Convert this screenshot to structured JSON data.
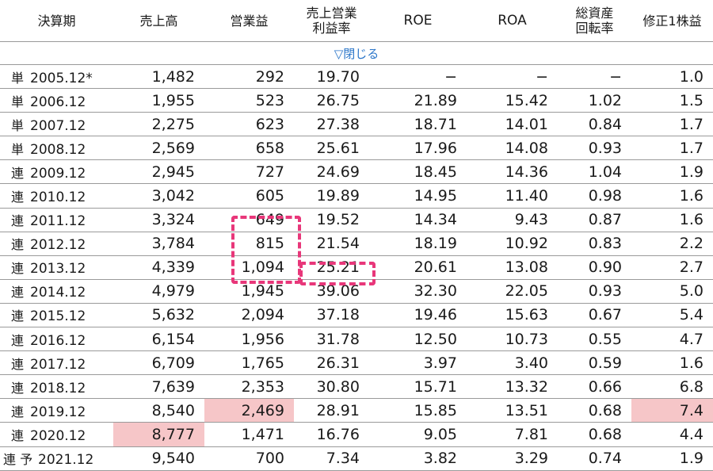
{
  "headers": {
    "period": "決算期",
    "sales": "売上高",
    "operating_profit": "営業益",
    "margin_line1": "売上営業",
    "margin_line2": "利益率",
    "roe": "ROE",
    "roa": "ROA",
    "turnover_line1": "総資産",
    "turnover_line2": "回転率",
    "eps": "修正1株益"
  },
  "toggle_label": "▽閉じる",
  "highlight_color": "#f6c6c8",
  "annotation_color": "#e8377a",
  "rows": [
    {
      "type": "単",
      "date": "2005.12*",
      "sales": "1,482",
      "op": "292",
      "margin": "19.70",
      "roe": "−",
      "roa": "−",
      "turnover": "−",
      "eps": "1.0"
    },
    {
      "type": "単",
      "date": "2006.12",
      "sales": "1,955",
      "op": "523",
      "margin": "26.75",
      "roe": "21.89",
      "roa": "15.42",
      "turnover": "1.02",
      "eps": "1.5"
    },
    {
      "type": "単",
      "date": "2007.12",
      "sales": "2,275",
      "op": "623",
      "margin": "27.38",
      "roe": "18.71",
      "roa": "14.01",
      "turnover": "0.84",
      "eps": "1.7"
    },
    {
      "type": "単",
      "date": "2008.12",
      "sales": "2,569",
      "op": "658",
      "margin": "25.61",
      "roe": "17.96",
      "roa": "14.08",
      "turnover": "0.93",
      "eps": "1.7"
    },
    {
      "type": "連",
      "date": "2009.12",
      "sales": "2,945",
      "op": "727",
      "margin": "24.69",
      "roe": "18.45",
      "roa": "14.36",
      "turnover": "1.04",
      "eps": "1.9"
    },
    {
      "type": "連",
      "date": "2010.12",
      "sales": "3,042",
      "op": "605",
      "margin": "19.89",
      "roe": "14.95",
      "roa": "11.40",
      "turnover": "0.98",
      "eps": "1.6"
    },
    {
      "type": "連",
      "date": "2011.12",
      "sales": "3,324",
      "op": "649",
      "margin": "19.52",
      "roe": "14.34",
      "roa": "9.43",
      "turnover": "0.87",
      "eps": "1.6"
    },
    {
      "type": "連",
      "date": "2012.12",
      "sales": "3,784",
      "op": "815",
      "margin": "21.54",
      "roe": "18.19",
      "roa": "10.92",
      "turnover": "0.83",
      "eps": "2.2"
    },
    {
      "type": "連",
      "date": "2013.12",
      "sales": "4,339",
      "op": "1,094",
      "margin": "25.21",
      "roe": "20.61",
      "roa": "13.08",
      "turnover": "0.90",
      "eps": "2.7"
    },
    {
      "type": "連",
      "date": "2014.12",
      "sales": "4,979",
      "op": "1,945",
      "margin": "39.06",
      "roe": "32.30",
      "roa": "22.05",
      "turnover": "0.93",
      "eps": "5.0"
    },
    {
      "type": "連",
      "date": "2015.12",
      "sales": "5,632",
      "op": "2,094",
      "margin": "37.18",
      "roe": "19.46",
      "roa": "15.63",
      "turnover": "0.67",
      "eps": "5.4"
    },
    {
      "type": "連",
      "date": "2016.12",
      "sales": "6,154",
      "op": "1,956",
      "margin": "31.78",
      "roe": "12.50",
      "roa": "10.73",
      "turnover": "0.55",
      "eps": "4.7"
    },
    {
      "type": "連",
      "date": "2017.12",
      "sales": "6,709",
      "op": "1,765",
      "margin": "26.31",
      "roe": "3.97",
      "roa": "3.40",
      "turnover": "0.59",
      "eps": "1.6"
    },
    {
      "type": "連",
      "date": "2018.12",
      "sales": "7,639",
      "op": "2,353",
      "margin": "30.80",
      "roe": "15.71",
      "roa": "13.32",
      "turnover": "0.66",
      "eps": "6.8"
    },
    {
      "type": "連",
      "date": "2019.12",
      "sales": "8,540",
      "op": "2,469",
      "margin": "28.91",
      "roe": "15.85",
      "roa": "13.51",
      "turnover": "0.68",
      "eps": "7.4",
      "hl": [
        "op",
        "eps"
      ]
    },
    {
      "type": "連",
      "date": "2020.12",
      "sales": "8,777",
      "op": "1,471",
      "margin": "16.76",
      "roe": "9.05",
      "roa": "7.81",
      "turnover": "0.68",
      "eps": "4.4",
      "hl": [
        "sales"
      ]
    },
    {
      "type": "連 予",
      "date": "2021.12",
      "sales": "9,540",
      "op": "700",
      "margin": "7.34",
      "roe": "3.82",
      "roa": "3.29",
      "turnover": "0.74",
      "eps": "1.9"
    }
  ]
}
